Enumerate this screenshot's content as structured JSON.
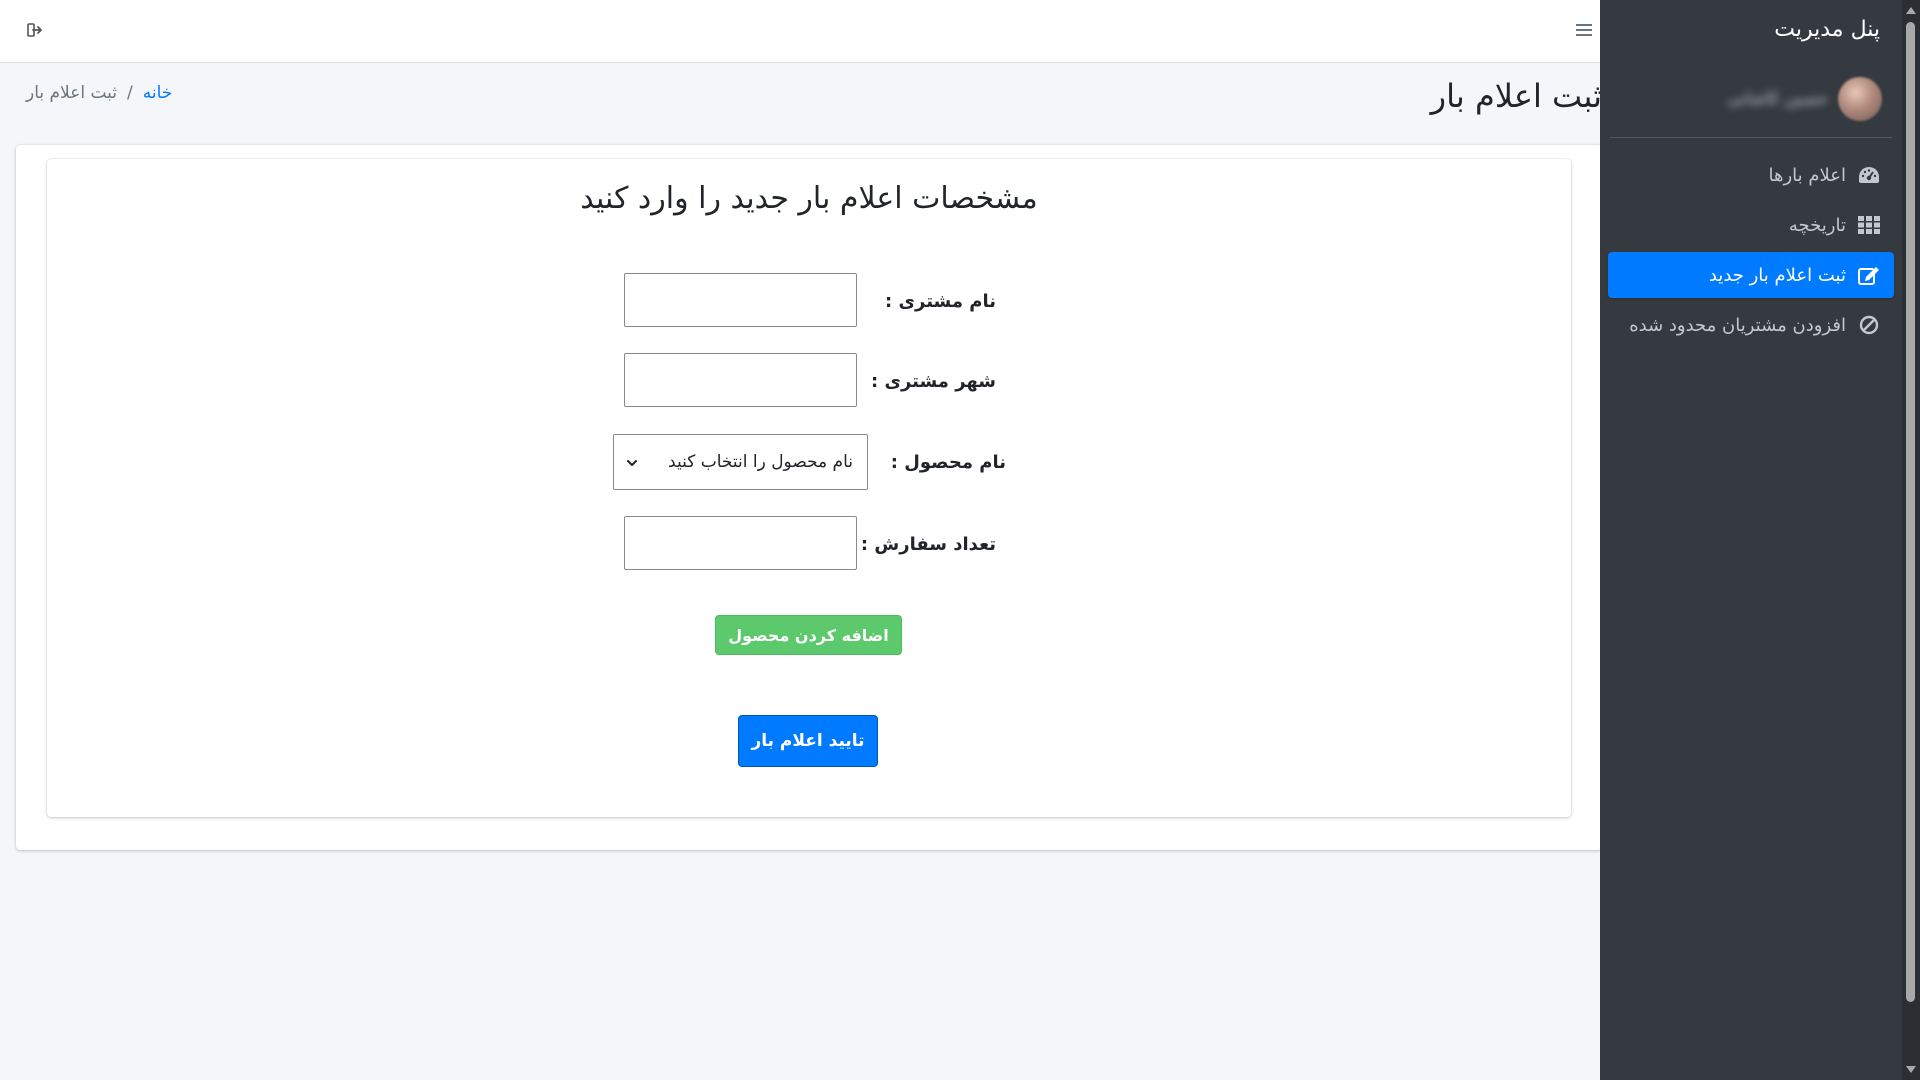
{
  "sidebar": {
    "brand": "پنل مدیریت",
    "user_name": "حسین کاشانی",
    "items": [
      {
        "label": "اعلام بارها",
        "icon": "dashboard-gauge-icon"
      },
      {
        "label": "تاریخچه",
        "icon": "grid-icon"
      },
      {
        "label": "ثبت اعلام بار جدید",
        "icon": "edit-icon",
        "active": true
      },
      {
        "label": "افزودن مشتریان محدود شده",
        "icon": "ban-icon"
      }
    ]
  },
  "topbar": {
    "logout_icon": "logout-icon",
    "menu_icon": "hamburger-menu-icon"
  },
  "header": {
    "title": "ثبت اعلام بار",
    "breadcrumb": {
      "home": "خانه",
      "separator": "/",
      "current": "ثبت اعلام بار"
    }
  },
  "form": {
    "title": "مشخصات اعلام بار جدید را وارد کنید",
    "customer_name_label": "نام مشتری :",
    "customer_name_value": "",
    "customer_city_label": "شهر مشتری :",
    "customer_city_value": "",
    "product_label": "نام محصول :",
    "product_select_value": "نام محصول را انتخاب کنید",
    "quantity_label": "تعداد سفارش :",
    "quantity_value": "",
    "add_product_button": "اضافه کردن محصول",
    "submit_button": "تایید اعلام بار"
  },
  "colors": {
    "sidebar_bg": "#343a40",
    "active_item": "#007bff",
    "add_button": "#5cc96c",
    "submit_button": "#007bff",
    "link": "#007bff"
  }
}
